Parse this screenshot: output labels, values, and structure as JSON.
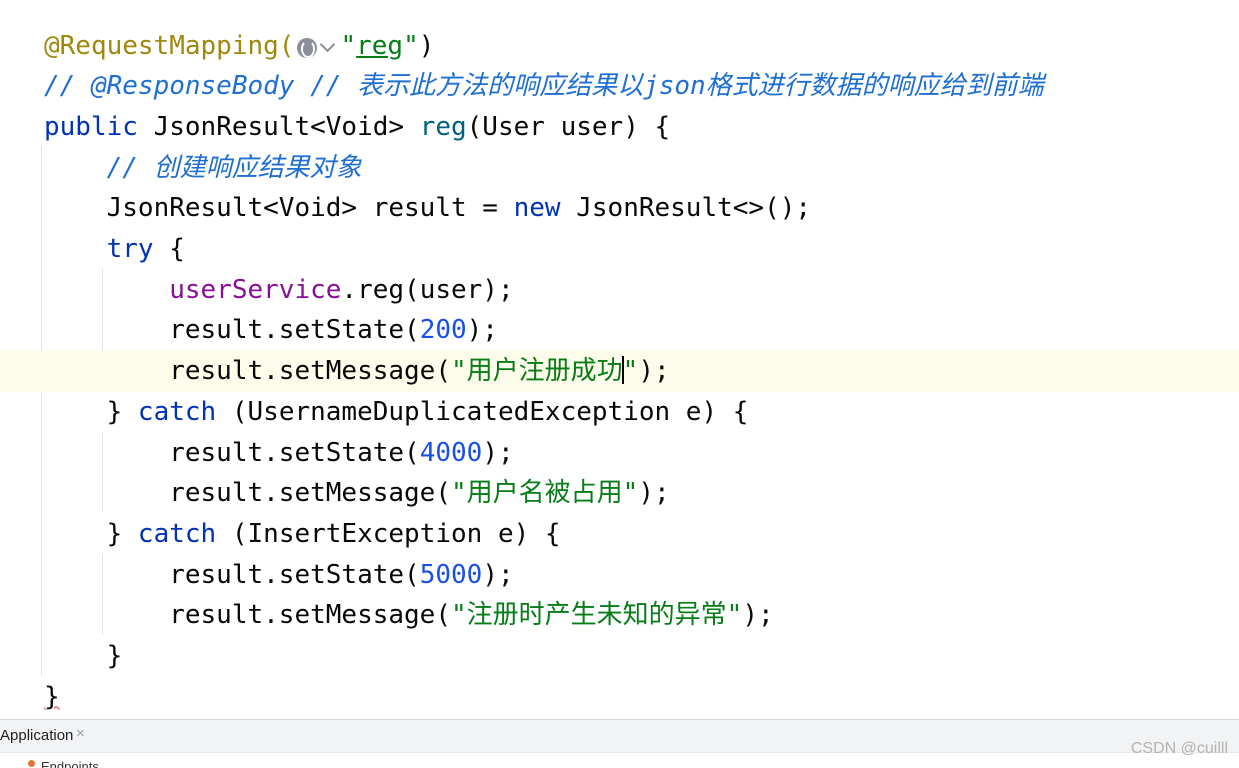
{
  "editor": {
    "lines": [
      [
        {
          "text": "@RequestMapping(",
          "cls": "ann"
        },
        {
          "icon": "globe"
        },
        {
          "text": "\"",
          "cls": "str"
        },
        {
          "text": "reg",
          "cls": "str reg-under"
        },
        {
          "text": "\"",
          "cls": "str"
        },
        {
          "text": ")",
          "cls": ""
        }
      ],
      [
        {
          "text": "// @ResponseBody // 表示此方法的响应结果以json格式进行数据的响应给到前端",
          "cls": "cm-blue"
        }
      ],
      [
        {
          "text": "public",
          "cls": "kw"
        },
        {
          "text": " JsonResult<Void> ",
          "cls": ""
        },
        {
          "text": "reg",
          "cls": "mth"
        },
        {
          "text": "(User user) {",
          "cls": ""
        }
      ],
      [
        {
          "text": "    ",
          "cls": ""
        },
        {
          "text": "// 创建响应结果对象",
          "cls": "cm-blue"
        }
      ],
      [
        {
          "text": "    JsonResult<Void> result = ",
          "cls": ""
        },
        {
          "text": "new",
          "cls": "kw"
        },
        {
          "text": " JsonResult<>();",
          "cls": ""
        }
      ],
      [
        {
          "text": "    ",
          "cls": ""
        },
        {
          "text": "try",
          "cls": "kw"
        },
        {
          "text": " {",
          "cls": ""
        }
      ],
      [
        {
          "text": "        ",
          "cls": ""
        },
        {
          "text": "userService",
          "cls": "field"
        },
        {
          "text": ".reg(user);",
          "cls": ""
        }
      ],
      [
        {
          "text": "        result.setState(",
          "cls": ""
        },
        {
          "text": "200",
          "cls": "num"
        },
        {
          "text": ");",
          "cls": ""
        }
      ],
      [
        {
          "text": "        result.setMessage(",
          "cls": ""
        },
        {
          "text": "\"用户注册成功",
          "cls": "str"
        },
        {
          "caret": true
        },
        {
          "text": "\"",
          "cls": "str"
        },
        {
          "text": ");",
          "cls": ""
        }
      ],
      [
        {
          "text": "    } ",
          "cls": ""
        },
        {
          "text": "catch",
          "cls": "kw"
        },
        {
          "text": " (UsernameDuplicatedException e) {",
          "cls": ""
        }
      ],
      [
        {
          "text": "        result.setState(",
          "cls": ""
        },
        {
          "text": "4000",
          "cls": "num"
        },
        {
          "text": ");",
          "cls": ""
        }
      ],
      [
        {
          "text": "        result.setMessage(",
          "cls": ""
        },
        {
          "text": "\"用户名被占用\"",
          "cls": "str"
        },
        {
          "text": ");",
          "cls": ""
        }
      ],
      [
        {
          "text": "    } ",
          "cls": ""
        },
        {
          "text": "catch",
          "cls": "kw"
        },
        {
          "text": " (InsertException e) {",
          "cls": ""
        }
      ],
      [
        {
          "text": "        result.setState(",
          "cls": ""
        },
        {
          "text": "5000",
          "cls": "num"
        },
        {
          "text": ");",
          "cls": ""
        }
      ],
      [
        {
          "text": "        result.setMessage(",
          "cls": ""
        },
        {
          "text": "\"注册时产生未知的异常\"",
          "cls": "str"
        },
        {
          "text": ");",
          "cls": ""
        }
      ],
      [
        {
          "text": "    }",
          "cls": ""
        }
      ],
      [
        {
          "text": "}",
          "cls": "squiggle"
        }
      ]
    ],
    "current_line": 8
  },
  "tool_window": {
    "tab_label": "Application",
    "tab_close": "×",
    "bottom_item": "Endpoints"
  },
  "watermark": "CSDN @cuilll"
}
